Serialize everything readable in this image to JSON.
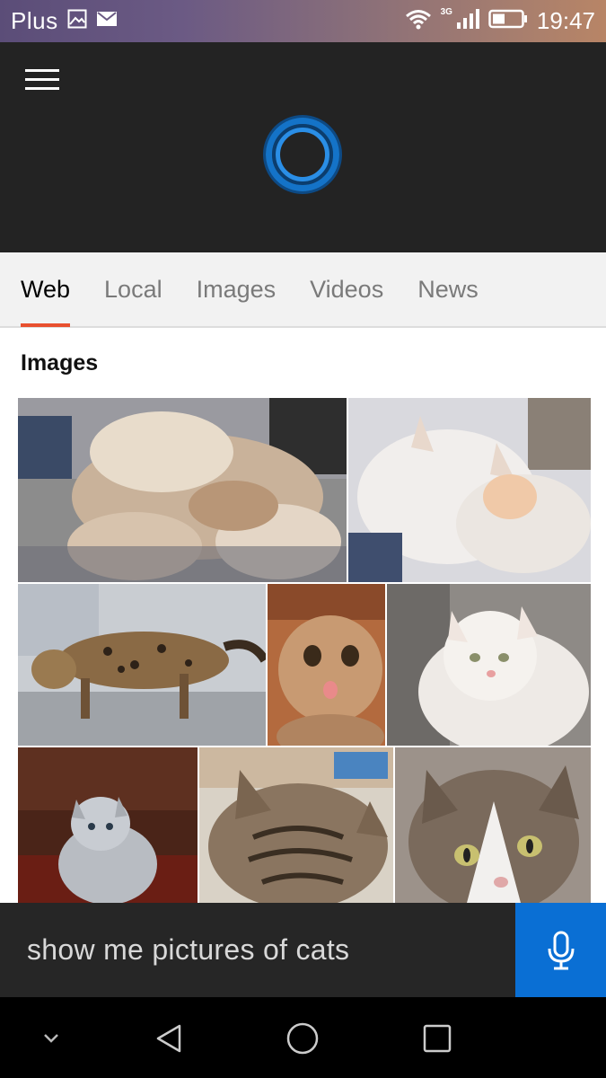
{
  "status_bar": {
    "carrier": "Plus",
    "network": "3G",
    "time": "19:47",
    "icons": [
      "image-icon",
      "mail-icon",
      "wifi-icon",
      "signal-icon",
      "battery-icon"
    ]
  },
  "header": {
    "menu_icon": "hamburger-menu-icon",
    "assistant_icon": "cortana-ring-icon",
    "accent_color": "#1473c8"
  },
  "tabs": [
    {
      "label": "Web",
      "active": true
    },
    {
      "label": "Local",
      "active": false
    },
    {
      "label": "Images",
      "active": false
    },
    {
      "label": "Videos",
      "active": false
    },
    {
      "label": "News",
      "active": false
    }
  ],
  "content": {
    "section_title": "Images",
    "images": [
      {
        "subject": "close-up of cat paws on carpet"
      },
      {
        "subject": "two white kittens sleeping together"
      },
      {
        "subject": "bengal cat walking"
      },
      {
        "subject": "scottish fold kitten sticking out tongue"
      },
      {
        "subject": "white cat lying down"
      },
      {
        "subject": "fluffy gray kitten"
      },
      {
        "subject": "tabby cat close-up"
      },
      {
        "subject": "tabby and white cat face"
      }
    ]
  },
  "search": {
    "query": "show me pictures of cats",
    "mic_icon": "microphone-icon",
    "mic_color": "#0a6fd4"
  },
  "nav_bar": {
    "icons": [
      "chevron-down-icon",
      "back-triangle-icon",
      "home-circle-icon",
      "recents-square-icon"
    ]
  }
}
